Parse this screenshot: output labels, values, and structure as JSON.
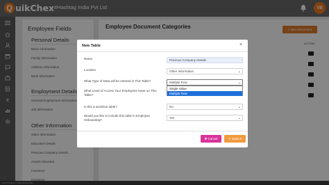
{
  "app": {
    "logo_letter": "Q",
    "logo_text": "uikChex",
    "company": "#Hashtag India Pvt Ltd",
    "avatar": "VB"
  },
  "sidebar": {
    "title": "Employee Fields",
    "personal_title": "Personal Details",
    "personal_items": [
      "Basic Information",
      "Family Information",
      "Address Information",
      "Bank Information"
    ],
    "employment_title": "Employment Details",
    "employment_items": [
      "General Employment Information",
      "Job Information"
    ],
    "other_title": "Other Information",
    "other_items": [
      "Other Information",
      "Education Details",
      "Previous Company Details",
      "Assets Allocated",
      "Insurance",
      "Insurance"
    ]
  },
  "main": {
    "title": "Employee Document Categories",
    "new_button": "+ New Document",
    "action_header": "ACTIONS"
  },
  "footer": {
    "text": "COPYRIGHT © 2023 QUIKCHEX"
  },
  "modal": {
    "title": "New Table",
    "close": "×",
    "name_label": "Name",
    "name_value": "Previous Company Details",
    "location_label": "Location",
    "location_value": "Other Information",
    "datatype_label": "What Type of Data will be entered in This Table?",
    "datatype_value": "Multiple Row",
    "datatype_options": [
      "Single Value",
      "Multiple Row"
    ],
    "access_label": "What Level of Access Your Employees Have on This Table?",
    "sensitive_label": "Is this a sensitive table?",
    "sensitive_value": "No",
    "onboarding_label": "Would you like to include this table in Employee Onboarding?",
    "onboarding_value": "Yes",
    "cancel": "✖ Cancel",
    "submit": "✔ Submit"
  },
  "colors": {
    "accent": "#f47b20",
    "cancel": "#d9339a",
    "submit": "#f19a3e",
    "selected_option": "#1e6fd9"
  }
}
